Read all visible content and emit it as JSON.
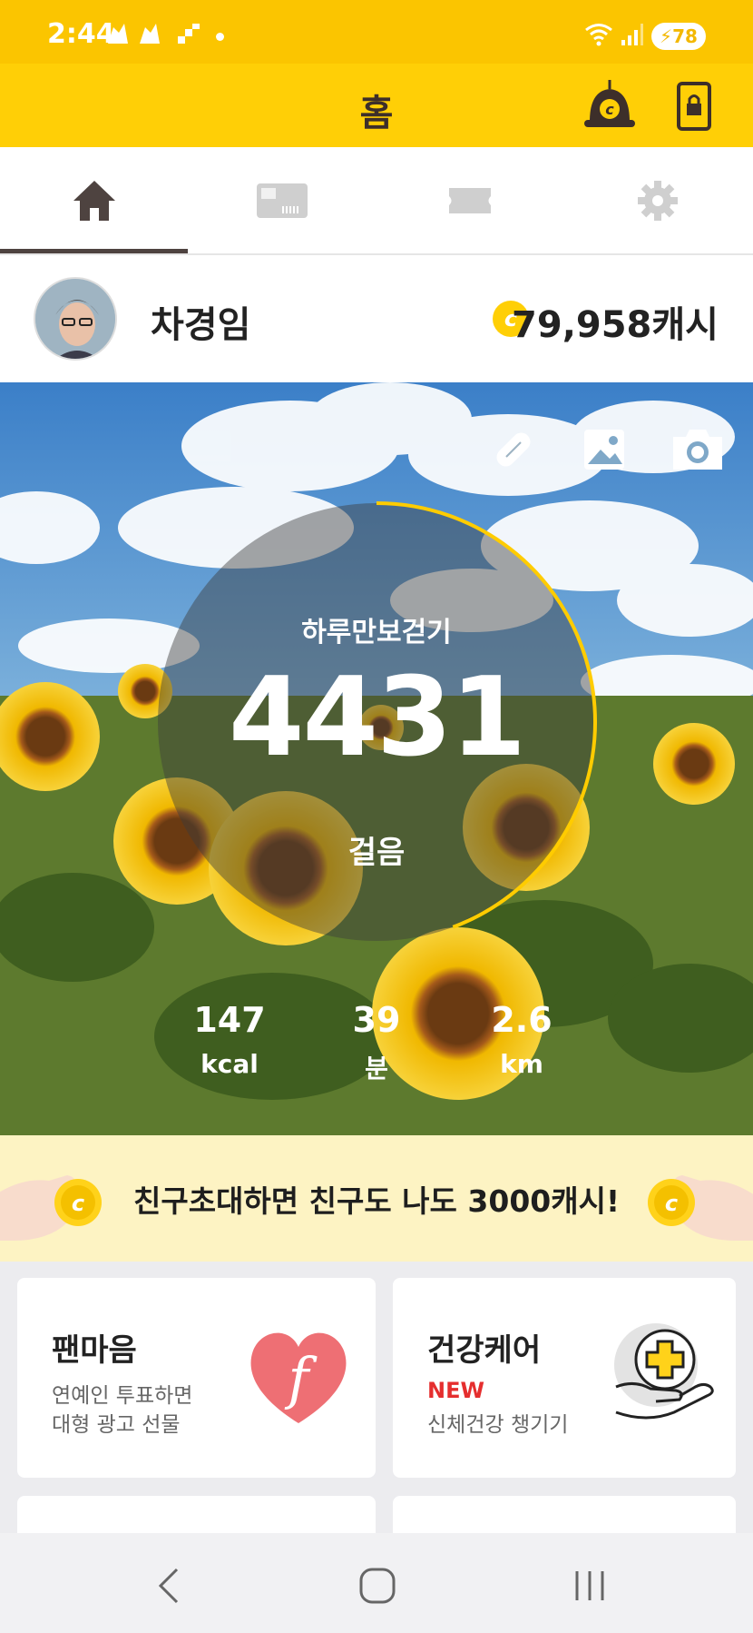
{
  "status_bar": {
    "time": "2:44",
    "battery": "78",
    "notification_icons": [
      "cash-app-icon",
      "cash-app-icon",
      "download-icon"
    ],
    "system_icons": [
      "wifi-icon",
      "signal-icon",
      "battery-icon"
    ]
  },
  "app_bar": {
    "title": "홈",
    "actions": [
      "cash-bell-icon",
      "phone-lock-icon"
    ]
  },
  "tabs": [
    {
      "name": "home",
      "icon": "home-icon",
      "selected": true
    },
    {
      "name": "coupon",
      "icon": "gift-card-icon",
      "selected": false
    },
    {
      "name": "ticket",
      "icon": "ticket-icon",
      "selected": false
    },
    {
      "name": "settings",
      "icon": "gear-icon",
      "selected": false
    }
  ],
  "profile": {
    "name": "차경임",
    "cash": "79,958캐시"
  },
  "hero": {
    "actions": [
      "pill-icon",
      "image-icon",
      "camera-icon"
    ],
    "gauge_label": "하루만보걷기",
    "steps": "4431",
    "steps_unit": "걸음",
    "progress": 0.4431,
    "stats": [
      {
        "value": "147",
        "unit": "kcal"
      },
      {
        "value": "39",
        "unit": "분"
      },
      {
        "value": "2.6",
        "unit": "km"
      }
    ]
  },
  "banner": {
    "text": "친구초대하면 친구도 나도 3000캐시!"
  },
  "cards": {
    "fanmaum": {
      "title": "팬마음",
      "line1": "연예인 투표하면",
      "line2": "대형 광고 선물",
      "icon": "fanmaum-heart-icon"
    },
    "health": {
      "title": "건강케어",
      "badge": "NEW",
      "line1": "신체건강 챙기기",
      "icon": "health-care-hand-icon"
    }
  },
  "nav_bar": {
    "buttons": [
      "back-icon",
      "home-circle-icon",
      "recents-icon"
    ]
  },
  "colors": {
    "brand_yellow": "#ffcf06",
    "status_yellow": "#fbc500",
    "dark_brown": "#3d2f2a",
    "banner_bg": "#fdf3c3",
    "new_red": "#e52e2e"
  }
}
